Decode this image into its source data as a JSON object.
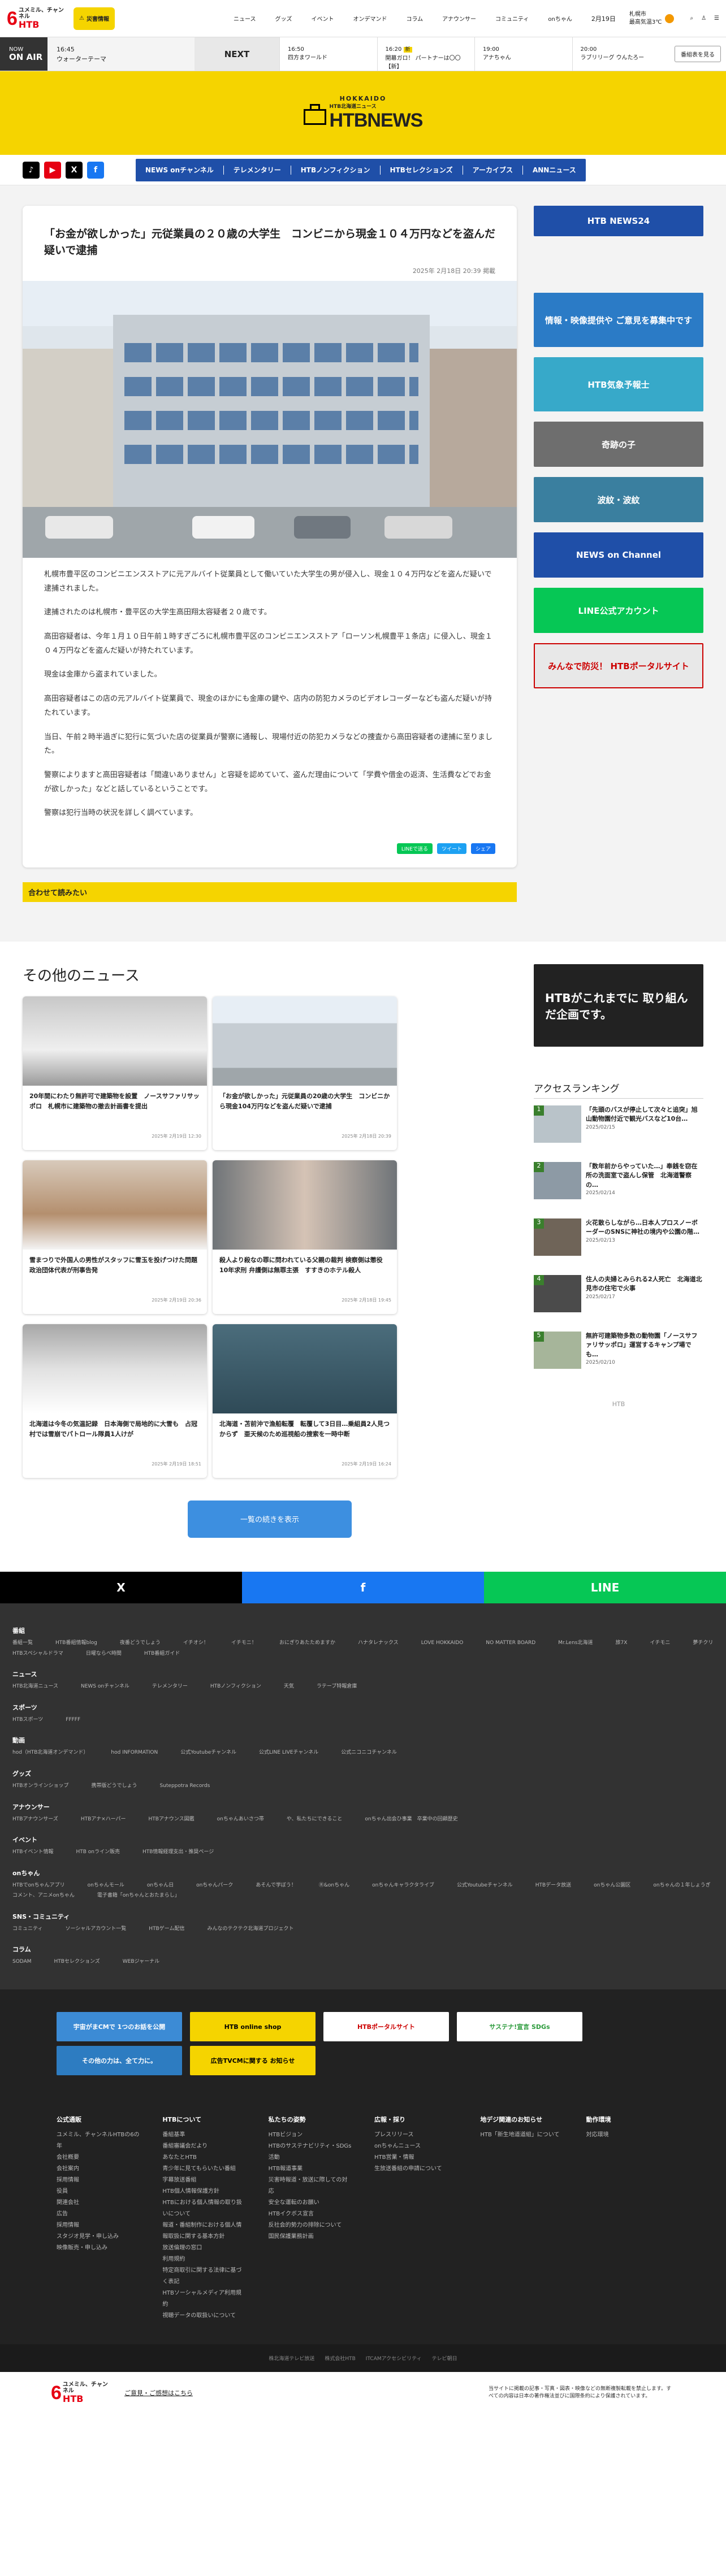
{
  "header": {
    "logo_six": "6",
    "logo_top": "ユメミル、チャンネル",
    "logo_bottom": "HTB",
    "disaster_label": "災害情報",
    "nav": [
      "ニュース",
      "グッズ",
      "イベント",
      "オンデマンド",
      "コラム",
      "アナウンサー",
      "コミュニティ",
      "onちゃん"
    ],
    "date": "2月19日",
    "weather_city": "札幌市",
    "weather_text": "最高気温3℃",
    "icons": [
      "search-icon",
      "account-icon",
      "menu-icon"
    ],
    "icon_labels": [
      "検索",
      "マイページ",
      "メニュー"
    ]
  },
  "onair": {
    "now_label": "NOW",
    "now_sub": "ON AIR",
    "current_time": "16:45",
    "current_title": "ウォーターテーマ",
    "next_label": "NEXT",
    "slots": [
      {
        "time": "16:50",
        "title": "四方まワールド"
      },
      {
        "time": "16:20",
        "tag": "新",
        "title": "開幕ガロ！ パートナーは〇〇 【新】"
      },
      {
        "time": "19:00",
        "title": "アナちゃん"
      },
      {
        "time": "20:00",
        "title": "ラブリリーグ ウんたろー"
      }
    ],
    "guide_label": "番組表を見る"
  },
  "brand": {
    "hokkaido": "HOKKAIDO",
    "sub": "HTB北海道ニュース",
    "name": "HTBNEWS"
  },
  "social": [
    "tiktok",
    "youtube",
    "x",
    "facebook"
  ],
  "navbar": [
    "NEWS onチャンネル",
    "テレメンタリー",
    "HTBノンフィクション",
    "HTBセレクションズ",
    "アーカイブス",
    "ANNニュース"
  ],
  "article": {
    "title": "「お金が欲しかった」元従業員の２０歳の大学生　コンビニから現金１０４万円などを盗んだ疑いで逮捕",
    "date": "2025年 2月18日 20:39 掲載",
    "paragraphs": [
      "札幌市豊平区のコンビニエンスストアに元アルバイト従業員として働いていた大学生の男が侵入し、現金１０４万円などを盗んだ疑いで逮捕されました。",
      "逮捕されたのは札幌市・豊平区の大学生高田翔太容疑者２０歳です。",
      "高田容疑者は、今年１月１０日午前１時すぎごろに札幌市豊平区のコンビニエンスストア「ローソン札幌豊平１条店」に侵入し、現金１０４万円などを盗んだ疑いが持たれています。",
      "現金は金庫から盗まれていました。",
      "高田容疑者はこの店の元アルバイト従業員で、現金のほかにも金庫の鍵や、店内の防犯カメラのビデオレコーダーなども盗んだ疑いが持たれています。",
      "当日、午前２時半過ぎに犯行に気づいた店の従業員が警察に通報し、現場付近の防犯カメラなどの捜査から高田容疑者の逮捕に至りました。",
      "警察によりますと高田容疑者は「間違いありません」と容疑を認めていて、盗んだ理由について「学費や借金の返済、生活費などでお金が欲しかった」などと話しているということです。",
      "警察は犯行当時の状況を詳しく調べています。"
    ],
    "share": [
      "LINEで送る",
      "ツイート",
      "シェア"
    ],
    "related": "合わせて読みたい"
  },
  "sidebar_banners": [
    "HTB NEWS24",
    "情報・映像提供や ご意見を募集中です",
    "HTB気象予報士",
    "奇跡の子",
    "波紋・波紋",
    "NEWS on Channel",
    "LINE公式アカウント",
    "みんなで防災！ HTBポータルサイト"
  ],
  "others": {
    "heading": "その他のニュース",
    "cards": [
      {
        "title": "20年間にわたり無許可で建築物を設置　ノースサファリサッポロ　札幌市に建築物の撤去計画書を提出",
        "date": "2025年 2月19日 12:30"
      },
      {
        "title": "「お金が欲しかった」元従業員の20歳の大学生　コンビニから現金104万円などを盗んだ疑いで逮捕",
        "date": "2025年 2月18日 20:39"
      },
      {
        "title": "雪まつりで外国人の男性がスタッフに雪玉を投げつけた問題　政治団体代表が刑事告発",
        "date": "2025年 2月19日 20:36"
      },
      {
        "title": "殺人より殺なの罪に問われている父親の裁判 検察側は懲役10年求刑 弁護側は無罪主張　すすきのホテル殺人",
        "date": "2025年 2月18日 19:45"
      },
      {
        "title": "北海道は今冬の気温記録　日本海側で局地的に大雪も　占冠村では雪崩でパトロール隊員1人けが",
        "date": "2025年 2月19日 18:51"
      },
      {
        "title": "北海道・苫前沖で漁船転覆　転覆して3日目…乗組員2人見つからず　亜天候のため巡視船の捜索を一時中断",
        "date": "2025年 2月19日 16:24"
      }
    ],
    "more_label": "一覧の続きを表示"
  },
  "side_ad": "HTBがこれまでに 取り組んだ企画です。",
  "ranking": {
    "heading": "アクセスランキング",
    "items": [
      {
        "num": "1",
        "title": "「先頭のバスが停止して次々と追突」旭山動物園付近で観光バスなど10台…",
        "date": "2025/02/15"
      },
      {
        "num": "2",
        "title": "「数年前からやっていた…」奉銭を窃在所の洗面室で盗んし保管　北海道警察の…",
        "date": "2025/02/14"
      },
      {
        "num": "3",
        "title": "火花散らしながら…日本人プロスノーボーダーのSNSに神社の境内や公園の階…",
        "date": "2025/02/13"
      },
      {
        "num": "4",
        "title": "住人の夫婦とみられる2人死亡　北海道北見市の住宅で火事",
        "date": "2025/02/17"
      },
      {
        "num": "5",
        "title": "無許可建築物多数の動物園「ノースサファリサッポロ」運営するキャンプ場でも…",
        "date": "2025/02/10"
      }
    ],
    "footer_logo": "HTB"
  },
  "share_bar": [
    "X",
    "f",
    "LINE"
  ],
  "sitemap": [
    {
      "h": "番組",
      "items": [
        "番組一覧",
        "HTB番組情報blog",
        "夜番どうでしょう",
        "イチオシ！",
        "イチモニ！",
        "おにぎりあたためますか",
        "ハナタレナックス",
        "LOVE HOKKAIDO",
        "NO MATTER BOARD",
        "Mr.Lens北海道",
        "旅7X",
        "イチモニ",
        "夢チクリ",
        "HTBスペシャルドラマ",
        "日曜ならべ時間",
        "HTB番組ガイド"
      ]
    },
    {
      "h": "ニュース",
      "items": [
        "HTB北海道ニュース",
        "NEWS onチャンネル",
        "テレメンタリー",
        "HTBノンフィクション",
        "天気",
        "ラテーブ特報倉庫"
      ]
    },
    {
      "h": "スポーツ",
      "items": [
        "HTBスポーツ",
        "FFFFF"
      ]
    },
    {
      "h": "動画",
      "items": [
        "hod（HTB北海道オンデマンド）",
        "hod INFORMATION",
        "公式Youtubeチャンネル",
        "公式LINE LIVEチャンネル",
        "公式ニコニコチャンネル"
      ]
    },
    {
      "h": "グッズ",
      "items": [
        "HTBオンラインショップ",
        "携帯版どうでしょう",
        "Suteppotra Records"
      ]
    },
    {
      "h": "アナウンサー",
      "items": [
        "HTBアナウンサーズ",
        "HTBアナ×ハーパー",
        "HTBアナウンス図鑑",
        "onちゃんあいさつ帯",
        "や、私たちにできること",
        "onちゃん出会ひ事業　卒業中の回顧歴史"
      ]
    },
    {
      "h": "イベント",
      "items": [
        "HTBイベント情報",
        "HTB onライン販売",
        "HTB情報経理支出・推奨ページ"
      ]
    },
    {
      "h": "onちゃん",
      "items": [
        "HTBでonちゃんアプリ",
        "onちゃんモール",
        "onちゃん日",
        "onちゃんパーク",
        "あそんで学ぼう！",
        "Ⓡ&onちゃん",
        "onちゃんキャラクタライブ",
        "公式Youtubeチャンネル",
        "HTBデータ放送",
        "onちゃん公園区",
        "onちゃんの１年しょうぎ",
        "コメント、アニメonちゃん",
        "電子書籍「onちゃんとおたまらし」"
      ]
    },
    {
      "h": "SNS・コミュニティ",
      "items": [
        "コミュニティ",
        "ソーシャルアカウント一覧",
        "HTBゲーム配信",
        "みんなのテクテク北海道プロジェクト"
      ]
    },
    {
      "h": "コラム",
      "items": [
        "SODAM",
        "HTBセレクションズ",
        "WEBジャーナル"
      ]
    }
  ],
  "footer_banners": [
    "宇宙がまCMで 1つのお話を公開",
    "HTB online shop",
    "HTBポータルサイト",
    "サステナ!宣言 SDGs",
    "その他の力は、全て力に。",
    "広告TVCMに関する お知らせ"
  ],
  "footer_links": [
    {
      "h": "公式通販",
      "items": [
        "ユメミル、チャンネルHTBの6の年",
        "会社概要",
        "会社案内",
        "採用情報",
        "役員",
        "関連会社",
        "広告",
        "採用情報",
        "スタジオ見学・申し込み",
        "映像販売・申し込み"
      ]
    },
    {
      "h": "HTBについて",
      "items": [
        "番組基準",
        "番組審議会だより",
        "あなたとHTB",
        "青少年に見てもらいたい番組",
        "字幕放送番組",
        "HTB個人情報保護方針",
        "HTBにおける個人情報の取り扱いについて",
        "報道・番組制作における個人情報取扱に関する基本方針",
        "放送倫理の窓口",
        "利用規約",
        "特定商取引に関する法律に基づく表記",
        "HTBソーシャルメディア利用規約",
        "視聴データの取扱いについて"
      ]
    },
    {
      "h": "私たちの姿勢",
      "items": [
        "HTBビジョン",
        "HTBのサステナビリティ・SDGs活動",
        "HTB報道事業",
        "災害時報道・放送に際しての対応",
        "安全な運転のお願い",
        "HTBイクボス宣言",
        "反社会的勢力の排除について",
        "国民保護業務計画"
      ]
    },
    {
      "h": "広報・採り",
      "items": [
        "プレスリリース",
        "onちゃんニュース",
        "HTB営業・情報",
        "生放送番組の申請について"
      ]
    },
    {
      "h": "地デジ関連のお知らせ",
      "items": [
        "HTB「新生地道道組」について"
      ]
    },
    {
      "h": "動作環境",
      "items": [
        "対応環境"
      ]
    }
  ],
  "copyright": "株北海道テレビ放送　　株式会社HTB　　ITCAMアクセシビリティ　　テレビ朝日",
  "bottom": {
    "logo": "HTB",
    "link": "ご意見・ご感想はこちら",
    "note": "当サイトに掲載の記事・写真・図表・映像などの無断複製転載を禁止します。すべての内容は日本の著作権法並びに国際条約により保護されています。"
  },
  "colors": {
    "yellow": "#f5d400",
    "navy": "#1f4fa8",
    "red": "#e60012",
    "dark": "#323232"
  }
}
